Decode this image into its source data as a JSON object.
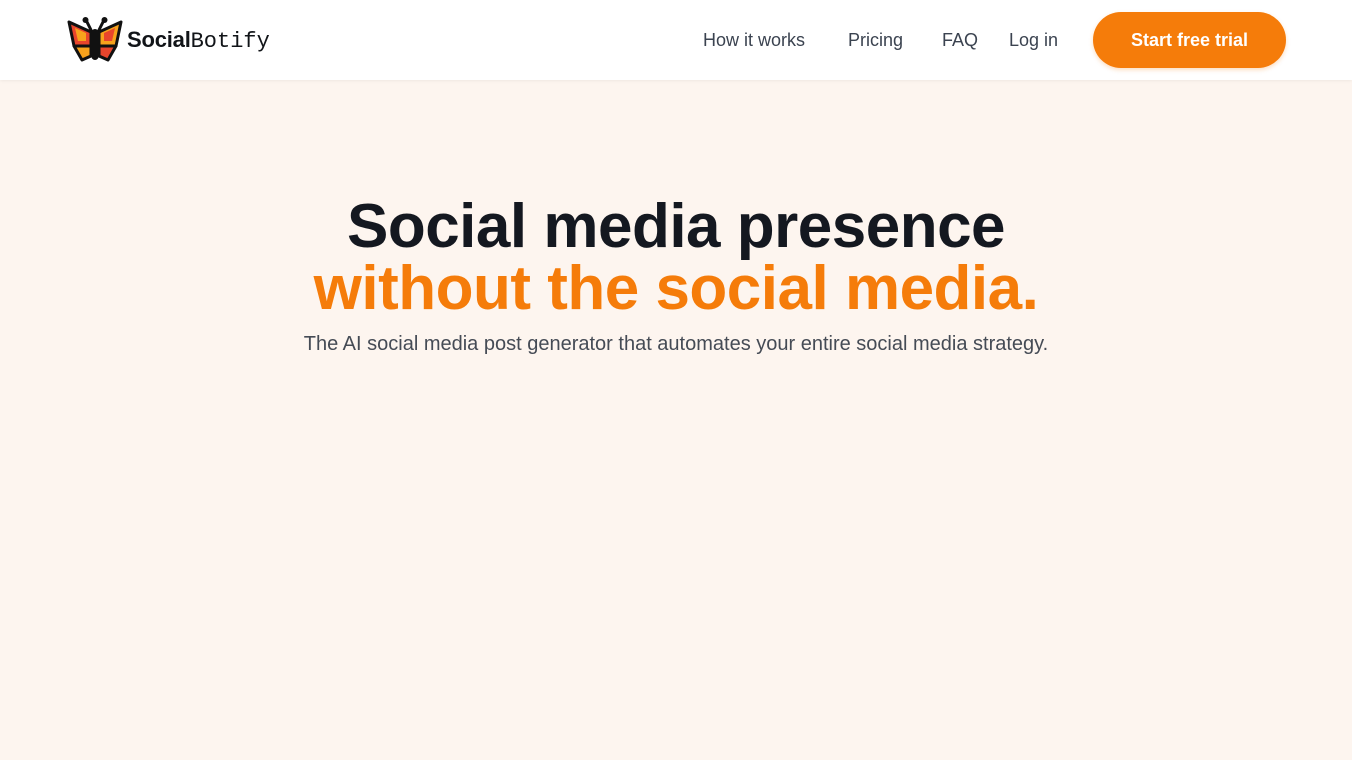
{
  "header": {
    "brand": {
      "bold": "Social",
      "mono": "Botify"
    },
    "nav": {
      "how_it_works": "How it works",
      "pricing": "Pricing",
      "faq": "FAQ",
      "log_in": "Log in"
    },
    "cta_label": "Start free trial"
  },
  "hero": {
    "headline_line1": "Social media presence",
    "headline_line2": "without the social media.",
    "subtitle": "The AI social media post generator that automates your entire social media strategy."
  },
  "colors": {
    "accent": "#f57c0a",
    "heading": "#141820",
    "background": "#fdf5ef"
  },
  "icons": {
    "logo": "butterfly-icon"
  }
}
